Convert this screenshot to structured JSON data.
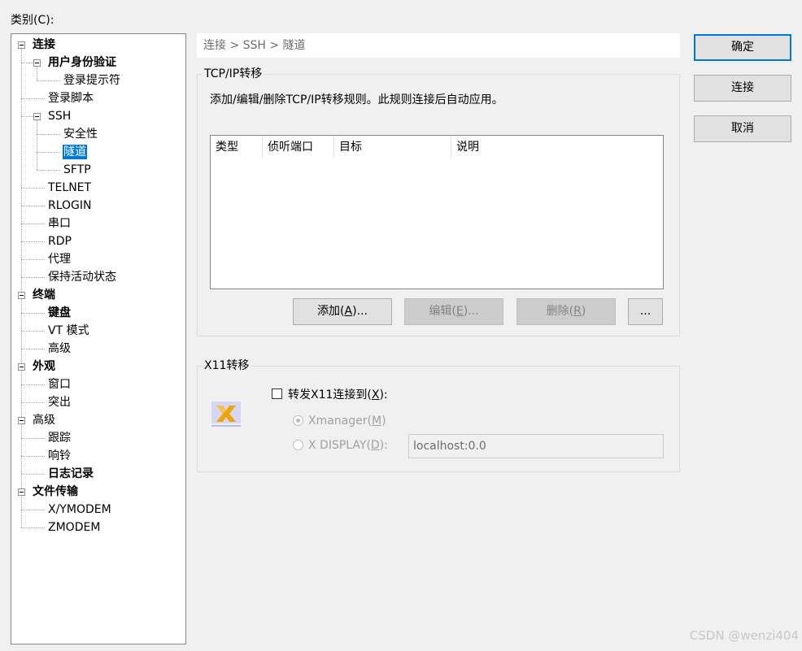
{
  "category_label": "类别(C):",
  "tree": [
    {
      "label": "连接",
      "level": 0,
      "bold": true
    },
    {
      "label": "用户身份验证",
      "level": 1,
      "bold": true
    },
    {
      "label": "登录提示符",
      "level": 2
    },
    {
      "label": "登录脚本",
      "level": 1
    },
    {
      "label": "SSH",
      "level": 1
    },
    {
      "label": "安全性",
      "level": 2
    },
    {
      "label": "隧道",
      "level": 2,
      "selected": true
    },
    {
      "label": "SFTP",
      "level": 2
    },
    {
      "label": "TELNET",
      "level": 1
    },
    {
      "label": "RLOGIN",
      "level": 1
    },
    {
      "label": "串口",
      "level": 1
    },
    {
      "label": "RDP",
      "level": 1
    },
    {
      "label": "代理",
      "level": 1
    },
    {
      "label": "保持活动状态",
      "level": 1
    },
    {
      "label": "终端",
      "level": 0,
      "bold": true
    },
    {
      "label": "键盘",
      "level": 1,
      "bold": true
    },
    {
      "label": "VT 模式",
      "level": 1
    },
    {
      "label": "高级",
      "level": 1
    },
    {
      "label": "外观",
      "level": 0,
      "bold": true
    },
    {
      "label": "窗口",
      "level": 1
    },
    {
      "label": "突出",
      "level": 1
    },
    {
      "label": "高级",
      "level": 0
    },
    {
      "label": "跟踪",
      "level": 1
    },
    {
      "label": "响铃",
      "level": 1
    },
    {
      "label": "日志记录",
      "level": 1,
      "bold": true
    },
    {
      "label": "文件传输",
      "level": 0,
      "bold": true
    },
    {
      "label": "X/YMODEM",
      "level": 1
    },
    {
      "label": "ZMODEM",
      "level": 1
    }
  ],
  "breadcrumb": "连接 > SSH > 隧道",
  "tcpip": {
    "title": "TCP/IP转移",
    "description": "添加/编辑/删除TCP/IP转移规则。此规则连接后自动应用。",
    "columns": [
      "类型",
      "侦听端口",
      "目标",
      "说明"
    ],
    "add_button": {
      "text": "添加(",
      "key": "A",
      "suffix": ")..."
    },
    "edit_button": {
      "text": "编辑(",
      "key": "E",
      "suffix": ")..."
    },
    "delete_button": {
      "text": "删除(",
      "key": "R",
      "suffix": ")"
    },
    "more_button": "..."
  },
  "x11": {
    "title": "X11转移",
    "forward_checkbox": {
      "text": "转发X11连接到(",
      "key": "X",
      "suffix": "):",
      "checked": false
    },
    "xmanager_radio": {
      "text": "Xmanager(",
      "key": "M",
      "suffix": ")",
      "checked": true
    },
    "xdisplay_radio": {
      "text": "X DISPLAY(",
      "key": "D",
      "suffix": "):",
      "checked": false
    },
    "display_value": "localhost:0.0",
    "icon": "xmanager-logo-icon"
  },
  "buttons": {
    "ok": "确定",
    "connect": "连接",
    "cancel": "取消"
  },
  "watermark": "CSDN @wenzi404",
  "colors": {
    "selection": "#0078d7",
    "logo_yellow": "#f0a500",
    "logo_bg": "#c9c9f0"
  }
}
